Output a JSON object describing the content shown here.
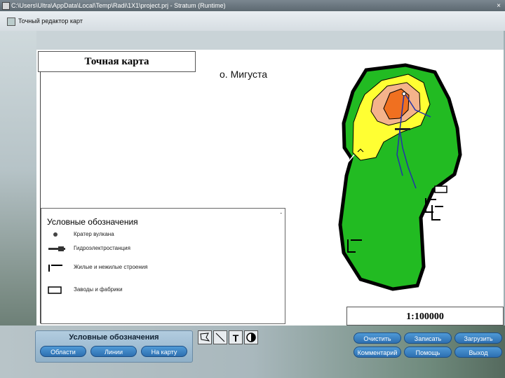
{
  "window": {
    "title": "C:\\Users\\Ultra\\AppData\\Local\\Temp\\Radi\\1X1\\project.prj - Stratum (Runtime)",
    "controls": "×"
  },
  "menubar": {
    "label": "Точный редактор карт"
  },
  "map": {
    "title": "Точная карта",
    "island_name": "о. Мигуста",
    "scale": "1:100000",
    "colors": {
      "lowland": "#22bb22",
      "outline": "#000000",
      "upland": "#ffff33",
      "mountain": "#f4b38b",
      "peak": "#f07020",
      "river": "#2233aa"
    }
  },
  "legend": {
    "title": "Условные обозначения",
    "close": "-",
    "items": [
      {
        "label": "Кратер вулкана",
        "icon": "crater-icon"
      },
      {
        "label": "Гидроэлектростанция",
        "icon": "hydro-plant-icon"
      },
      {
        "label": "Жилые и нежилые строения",
        "icon": "building-icon"
      },
      {
        "label": "Заводы и фабрики",
        "icon": "factory-icon"
      }
    ]
  },
  "left_panel": {
    "title": "Условные обозначения",
    "buttons": {
      "areas": "Области",
      "lines": "Линии",
      "to_map": "На карту"
    }
  },
  "tools": {
    "polygon": "polygon-tool-icon",
    "line": "line-tool-icon",
    "text": "T",
    "fill": "fill-tool-icon"
  },
  "right_panel": {
    "buttons": {
      "clear": "Очистить",
      "save": "Записать",
      "load": "Загрузить",
      "comment": "Комментарий",
      "help": "Помощь",
      "exit": "Выход"
    }
  }
}
